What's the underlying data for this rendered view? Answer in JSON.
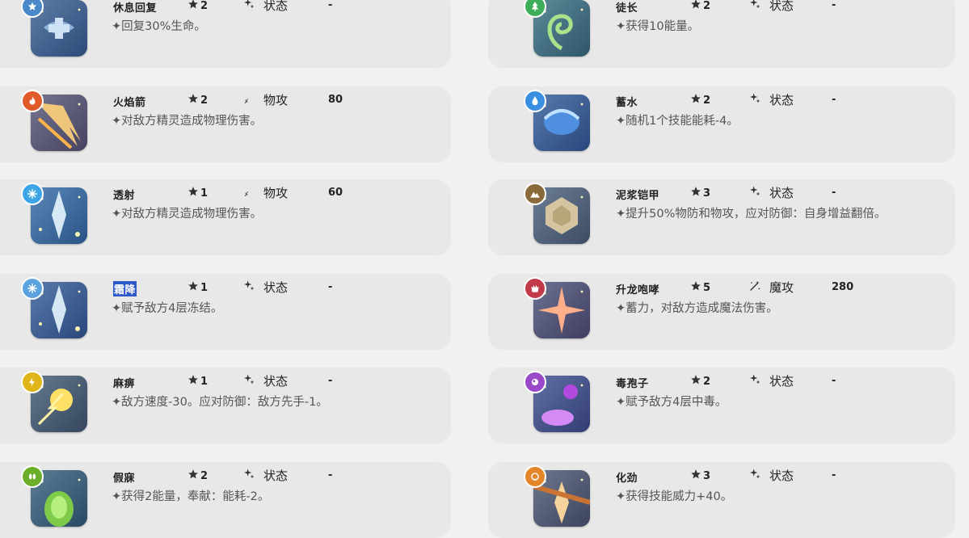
{
  "skills": [
    {
      "name": "休息回复",
      "cost": "2",
      "category": "状态",
      "power": "-",
      "description": "✦回复30%生命。",
      "element": "light",
      "badge_color": "#4a88c7",
      "art_palette": [
        "#2e4a78",
        "#6d8fb8"
      ],
      "category_icon": "sparkle-icon"
    },
    {
      "name": "徒长",
      "cost": "2",
      "category": "状态",
      "power": "-",
      "description": "✦获得10能量。",
      "element": "grass",
      "badge_color": "#3fae5a",
      "art_palette": [
        "#2d7a3c",
        "#7fc36b"
      ],
      "category_icon": "sparkle-icon"
    },
    {
      "name": "火焰箭",
      "cost": "2",
      "category": "物攻",
      "power": "80",
      "description": "✦对敌方精灵造成物理伤害。",
      "element": "fire",
      "badge_color": "#e05a2a",
      "art_palette": [
        "#8a2a1a",
        "#f6a041"
      ],
      "category_icon": "sword-icon"
    },
    {
      "name": "蓄水",
      "cost": "2",
      "category": "状态",
      "power": "-",
      "description": "✦随机1个技能能耗-4。",
      "element": "water",
      "badge_color": "#3b8fe0",
      "art_palette": [
        "#173e8c",
        "#5fa6e8"
      ],
      "category_icon": "sparkle-icon"
    },
    {
      "name": "透射",
      "cost": "1",
      "category": "物攻",
      "power": "60",
      "description": "✦对敌方精灵造成物理伤害。",
      "element": "ice",
      "badge_color": "#3ea6e6",
      "art_palette": [
        "#1f6fb8",
        "#bfe6fb"
      ],
      "category_icon": "sword-icon"
    },
    {
      "name": "泥浆铠甲",
      "cost": "3",
      "category": "状态",
      "power": "-",
      "description": "✦提升50%物防和物攻，应对防御：自身增益翻倍。",
      "element": "ground",
      "badge_color": "#8a6a3a",
      "art_palette": [
        "#6a4f2c",
        "#c9b58e"
      ],
      "category_icon": "sparkle-icon"
    },
    {
      "name": "霜降",
      "cost": "1",
      "category": "状态",
      "power": "-",
      "description": "✦赋予敌方4层冻结。",
      "element": "ice",
      "badge_color": "#5aa3e0",
      "art_palette": [
        "#1d3f86",
        "#7cc1ef"
      ],
      "category_icon": "sparkle-icon"
    },
    {
      "name": "升龙咆哮",
      "cost": "5",
      "category": "魔攻",
      "power": "280",
      "description": "✦蓄力，对敌方造成魔法伤害。",
      "element": "dragon",
      "badge_color": "#c23a4a",
      "art_palette": [
        "#6e1a1a",
        "#e98a6a"
      ],
      "category_icon": "magic-icon"
    },
    {
      "name": "麻痹",
      "cost": "1",
      "category": "状态",
      "power": "-",
      "description": "✦敌方速度-30。应对防御：敌方先手-1。",
      "element": "electric",
      "badge_color": "#e0b51a",
      "art_palette": [
        "#4a3a10",
        "#f4d24a"
      ],
      "category_icon": "sparkle-icon"
    },
    {
      "name": "毒孢子",
      "cost": "2",
      "category": "状态",
      "power": "-",
      "description": "✦赋予敌方4层中毒。",
      "element": "poison",
      "badge_color": "#9a4ac8",
      "art_palette": [
        "#3c1566",
        "#c25ae6"
      ],
      "category_icon": "sparkle-icon"
    },
    {
      "name": "假寐",
      "cost": "2",
      "category": "状态",
      "power": "-",
      "description": "✦获得2能量，奉献：能耗-2。",
      "element": "bug",
      "badge_color": "#6aae2a",
      "art_palette": [
        "#1f4a2a",
        "#7ecb4a"
      ],
      "category_icon": "sparkle-icon"
    },
    {
      "name": "化劲",
      "cost": "3",
      "category": "状态",
      "power": "-",
      "description": "✦获得技能威力+40。",
      "element": "fighting",
      "badge_color": "#e5862a",
      "art_palette": [
        "#6a3210",
        "#e8b062"
      ],
      "category_icon": "sparkle-icon"
    }
  ]
}
